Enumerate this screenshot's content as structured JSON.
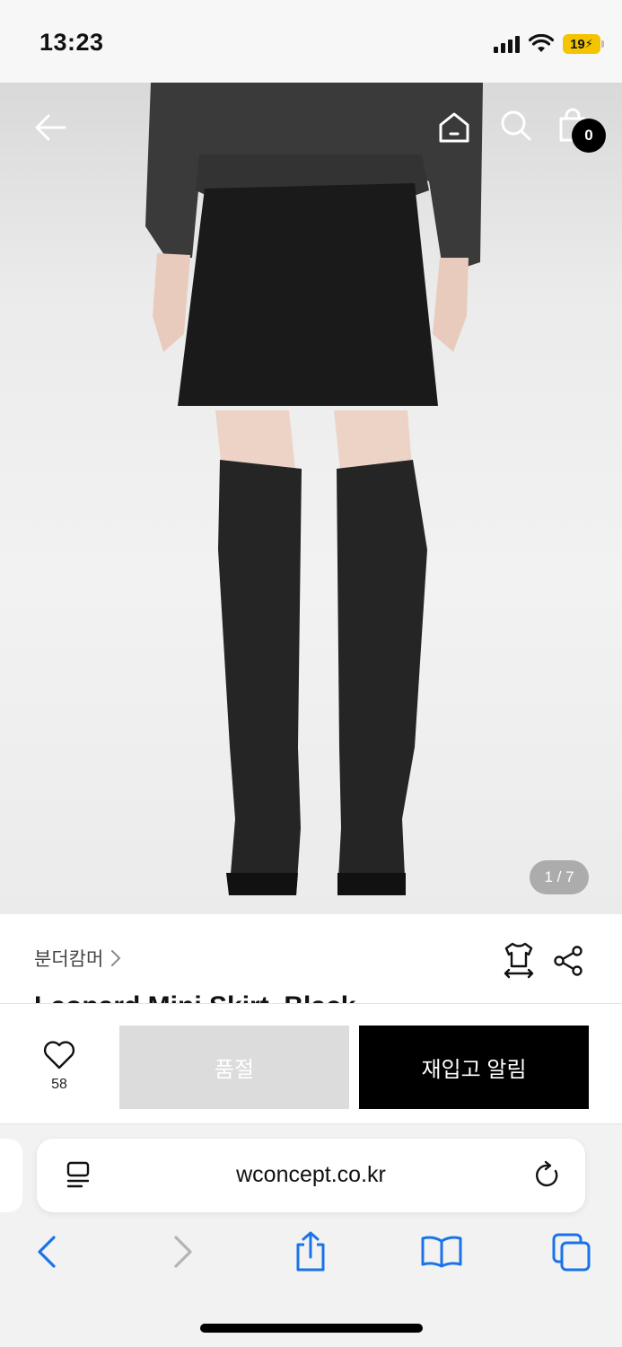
{
  "status_bar": {
    "time": "13:23",
    "battery": "19"
  },
  "header_nav": {
    "back_icon": "arrow-left-icon",
    "home_icon": "home-icon",
    "search_icon": "search-icon",
    "cart_icon": "shopping-bag-icon",
    "cart_count": "0"
  },
  "gallery": {
    "page_indicator": "1 / 7"
  },
  "product": {
    "brand": "분더캄머",
    "title": "Leopard Mini Skirt_Black"
  },
  "actions": {
    "like_count": "58",
    "soldout_label": "품절",
    "restock_label": "재입고 알림"
  },
  "browser": {
    "url": "wconcept.co.kr"
  },
  "colors": {
    "primary_button": "#000000",
    "disabled_button": "#dcdcdc",
    "safari_blue": "#1a73e8"
  }
}
